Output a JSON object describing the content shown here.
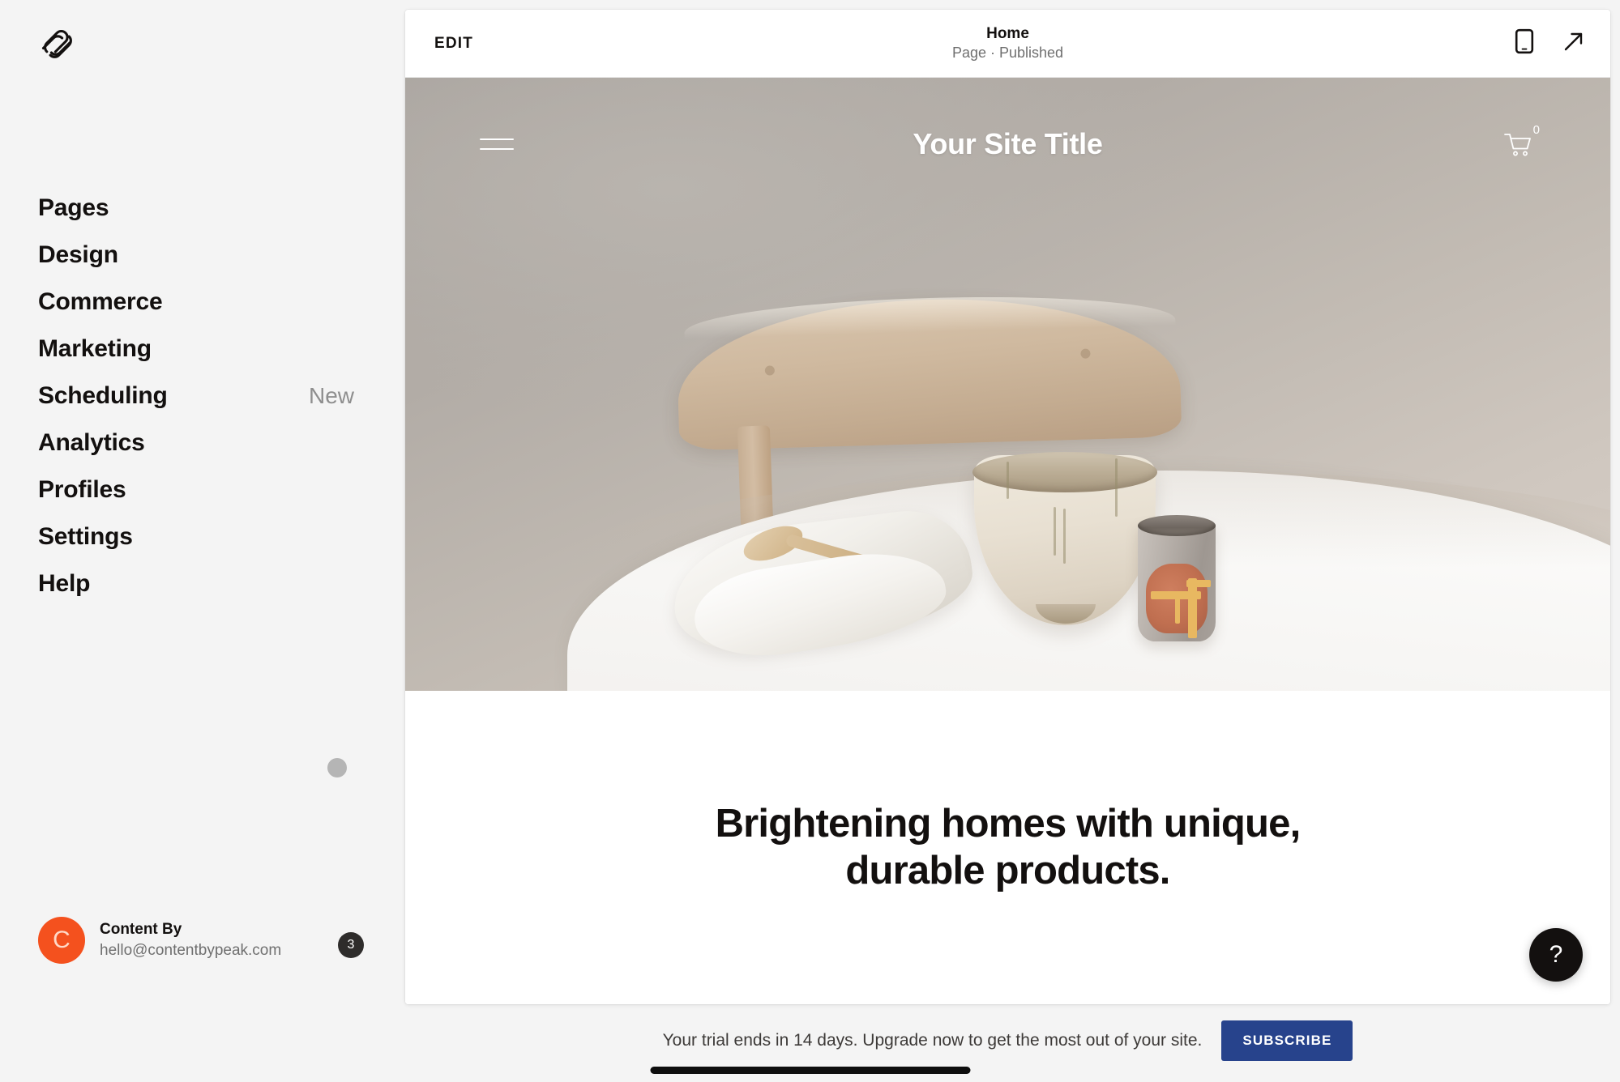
{
  "brand": {
    "logo_icon": "squarespace-logo-icon",
    "accent_color": "#f4511e",
    "subscribe_color": "#27438c"
  },
  "sidebar": {
    "items": [
      {
        "label": "Pages",
        "icon": "pages-icon",
        "badge": null
      },
      {
        "label": "Design",
        "icon": "design-icon",
        "badge": null
      },
      {
        "label": "Commerce",
        "icon": "commerce-icon",
        "badge": null
      },
      {
        "label": "Marketing",
        "icon": "marketing-icon",
        "badge": null
      },
      {
        "label": "Scheduling",
        "icon": "scheduling-icon",
        "badge": "New"
      },
      {
        "label": "Analytics",
        "icon": "analytics-icon",
        "badge": null
      },
      {
        "label": "Profiles",
        "icon": "profiles-icon",
        "badge": null
      },
      {
        "label": "Settings",
        "icon": "settings-icon",
        "badge": null
      },
      {
        "label": "Help",
        "icon": "help-icon",
        "badge": null
      }
    ],
    "profile": {
      "avatar_initial": "C",
      "name": "Content By",
      "email": "hello@contentbypeak.com",
      "notification_count": "3"
    }
  },
  "preview_bar": {
    "edit_label": "EDIT",
    "page_title": "Home",
    "page_status": "Page · Published",
    "mobile_icon": "mobile-preview-icon",
    "open_icon": "open-external-icon"
  },
  "site": {
    "menu_icon": "hamburger-menu-icon",
    "title": "Your Site Title",
    "cart_icon": "shopping-cart-icon",
    "cart_count": "0",
    "headline": "Brightening homes with unique, durable products.",
    "hero_image_alt": "Ceramic bowl, glazed cup, linen napkin and wooden spoon on a white round table in front of a light wood chair"
  },
  "help": {
    "label": "?",
    "icon": "question-mark-icon"
  },
  "trial": {
    "message": "Your trial ends in 14 days. Upgrade now to get the most out of your site.",
    "subscribe_label": "SUBSCRIBE"
  }
}
